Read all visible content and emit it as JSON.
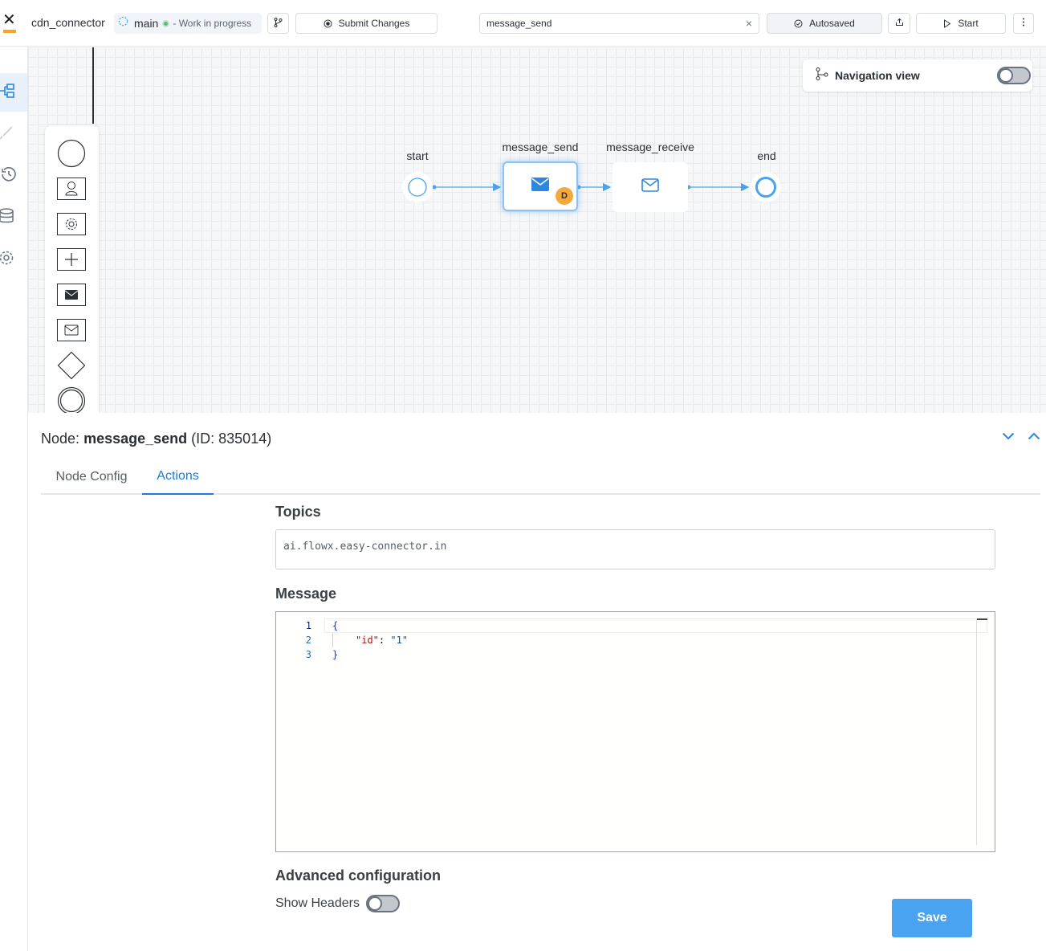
{
  "app": {
    "project_name": "cdn_connector"
  },
  "branch": {
    "name": "main",
    "status": "- Work in progress"
  },
  "toolbar": {
    "submit_label": "Submit Changes",
    "search_value": "message_send",
    "autosaved_label": "Autosaved",
    "start_label": "Start"
  },
  "canvas": {
    "navigation_view_label": "Navigation view",
    "navigation_view_on": false,
    "nodes": {
      "start": "start",
      "message_send": "message_send",
      "message_receive": "message_receive",
      "end": "end",
      "badge": "D"
    }
  },
  "panel": {
    "node_prefix": "Node:",
    "node_name": "message_send",
    "node_id": "(ID: 835014)",
    "tabs": [
      {
        "label": "Node Config",
        "active": false
      },
      {
        "label": "Actions",
        "active": true
      }
    ],
    "topics_title": "Topics",
    "topics_value": "ai.flowx.easy-connector.in",
    "message_title": "Message",
    "message_lines": [
      "1",
      "2",
      "3"
    ],
    "message_code": {
      "open": "{",
      "key": "\"id\"",
      "colon": ": ",
      "value": "\"1\"",
      "close": "}"
    },
    "advanced_title": "Advanced configuration",
    "show_headers_label": "Show Headers",
    "show_headers_on": false,
    "save_label": "Save"
  },
  "colors": {
    "accent": "#1f7ad6",
    "save": "#4aa3f0",
    "badge": "#f4a93c",
    "connector": "#4aa3f0"
  }
}
